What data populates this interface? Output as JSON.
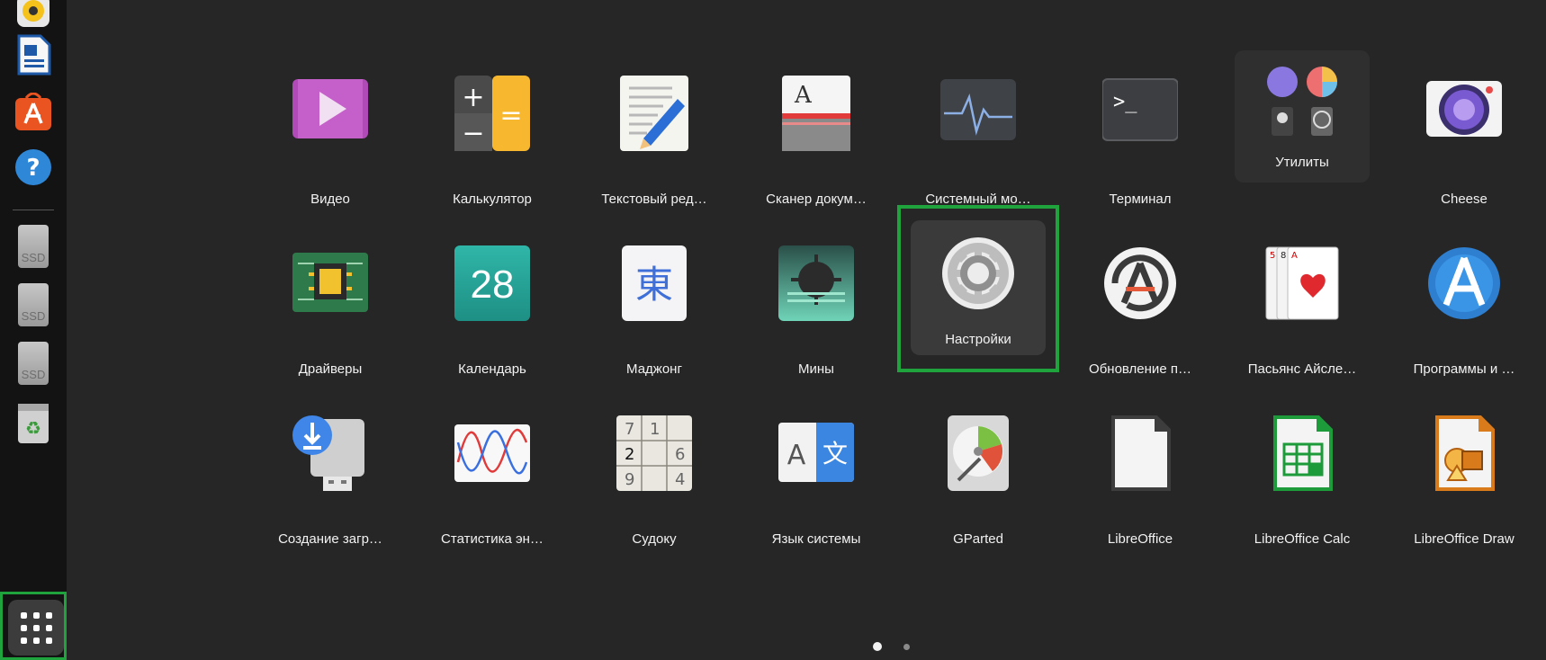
{
  "dock": {
    "items": [
      {
        "name": "rhythmbox-icon"
      },
      {
        "name": "libreoffice-writer-icon"
      },
      {
        "name": "app-center-icon"
      },
      {
        "name": "help-icon"
      },
      {
        "name": "ssd-drive-1-icon",
        "label": "SSD"
      },
      {
        "name": "ssd-drive-2-icon",
        "label": "SSD"
      },
      {
        "name": "ssd-drive-3-icon",
        "label": "SSD"
      },
      {
        "name": "trash-icon"
      }
    ],
    "show_apps_label": ""
  },
  "grid": {
    "row1": [
      {
        "label": "Видео"
      },
      {
        "label": "Калькулятор"
      },
      {
        "label": "Текстовый ред…"
      },
      {
        "label": "Сканер докум…"
      },
      {
        "label": "Системный мо…"
      },
      {
        "label": "Терминал"
      },
      {
        "label": "Утилиты"
      },
      {
        "label": "Cheese"
      }
    ],
    "row2": [
      {
        "label": "Драйверы"
      },
      {
        "label": "Календарь",
        "icon_text": "28"
      },
      {
        "label": "Маджонг",
        "icon_text": "東"
      },
      {
        "label": "Мины"
      },
      {
        "label": "Настройки"
      },
      {
        "label": "Обновление п…"
      },
      {
        "label": "Пасьянс Айсле…"
      },
      {
        "label": "Программы и …"
      }
    ],
    "row3": [
      {
        "label": "Создание загр…"
      },
      {
        "label": "Статистика эн…"
      },
      {
        "label": "Судоку"
      },
      {
        "label": "Язык системы"
      },
      {
        "label": "GParted"
      },
      {
        "label": "LibreOffice"
      },
      {
        "label": "LibreOffice Calc"
      },
      {
        "label": "LibreOffice Draw"
      }
    ]
  },
  "terminal_prompt": ">_",
  "pagination": {
    "current": 1,
    "total": 2
  },
  "colors": {
    "background": "#262626",
    "dock": "#131313",
    "highlight": "#1fa33c"
  }
}
